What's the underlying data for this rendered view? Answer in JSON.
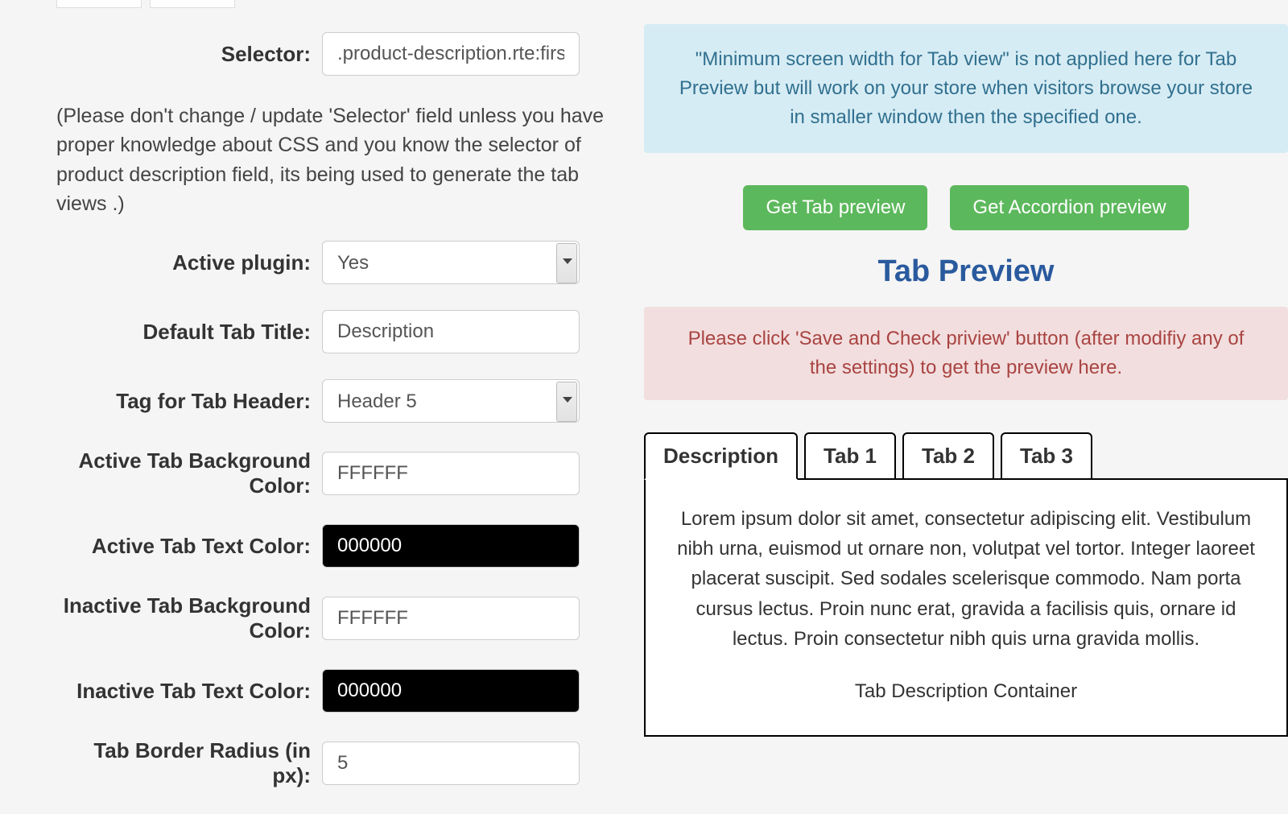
{
  "form": {
    "selector": {
      "label": "Selector:",
      "value": ".product-description.rte:first"
    },
    "note": "(Please don't change / update 'Selector' field unless you have proper knowledge about CSS and you know the selector of product description field, its being used to generate the tab views .)",
    "active_plugin": {
      "label": "Active plugin:",
      "value": "Yes"
    },
    "default_tab_title": {
      "label": "Default Tab Title:",
      "value": "Description"
    },
    "tag_for_tab_header": {
      "label": "Tag for Tab Header:",
      "value": "Header 5"
    },
    "active_tab_bg": {
      "label": "Active Tab Background Color:",
      "value": "FFFFFF"
    },
    "active_tab_text": {
      "label": "Active Tab Text Color:",
      "value": "000000"
    },
    "inactive_tab_bg": {
      "label": "Inactive Tab Background Color:",
      "value": "FFFFFF"
    },
    "inactive_tab_text": {
      "label": "Inactive Tab Text Color:",
      "value": "000000"
    },
    "tab_border_radius": {
      "label": "Tab Border Radius (in px):",
      "value": "5"
    }
  },
  "right": {
    "info_note": "\"Minimum screen width for Tab view\" is not applied here for Tab Preview but will work on your store when visitors browse your store in smaller window then the specified one.",
    "btn_tab_preview": "Get Tab preview",
    "btn_accordion_preview": "Get Accordion preview",
    "preview_title": "Tab Preview",
    "warn_note": "Please click 'Save and Check priview' button (after modifiy any of the settings) to get the preview here.",
    "tabs": [
      "Description",
      "Tab 1",
      "Tab 2",
      "Tab 3"
    ],
    "tab_body": "Lorem ipsum dolor sit amet, consectetur adipiscing elit. Vestibulum nibh urna, euismod ut ornare non, volutpat vel tortor. Integer laoreet placerat suscipit. Sed sodales scelerisque commodo. Nam porta cursus lectus. Proin nunc erat, gravida a facilisis quis, ornare id lectus. Proin consectetur nibh quis urna gravida mollis.",
    "tab_desc_label": "Tab Description Container"
  }
}
